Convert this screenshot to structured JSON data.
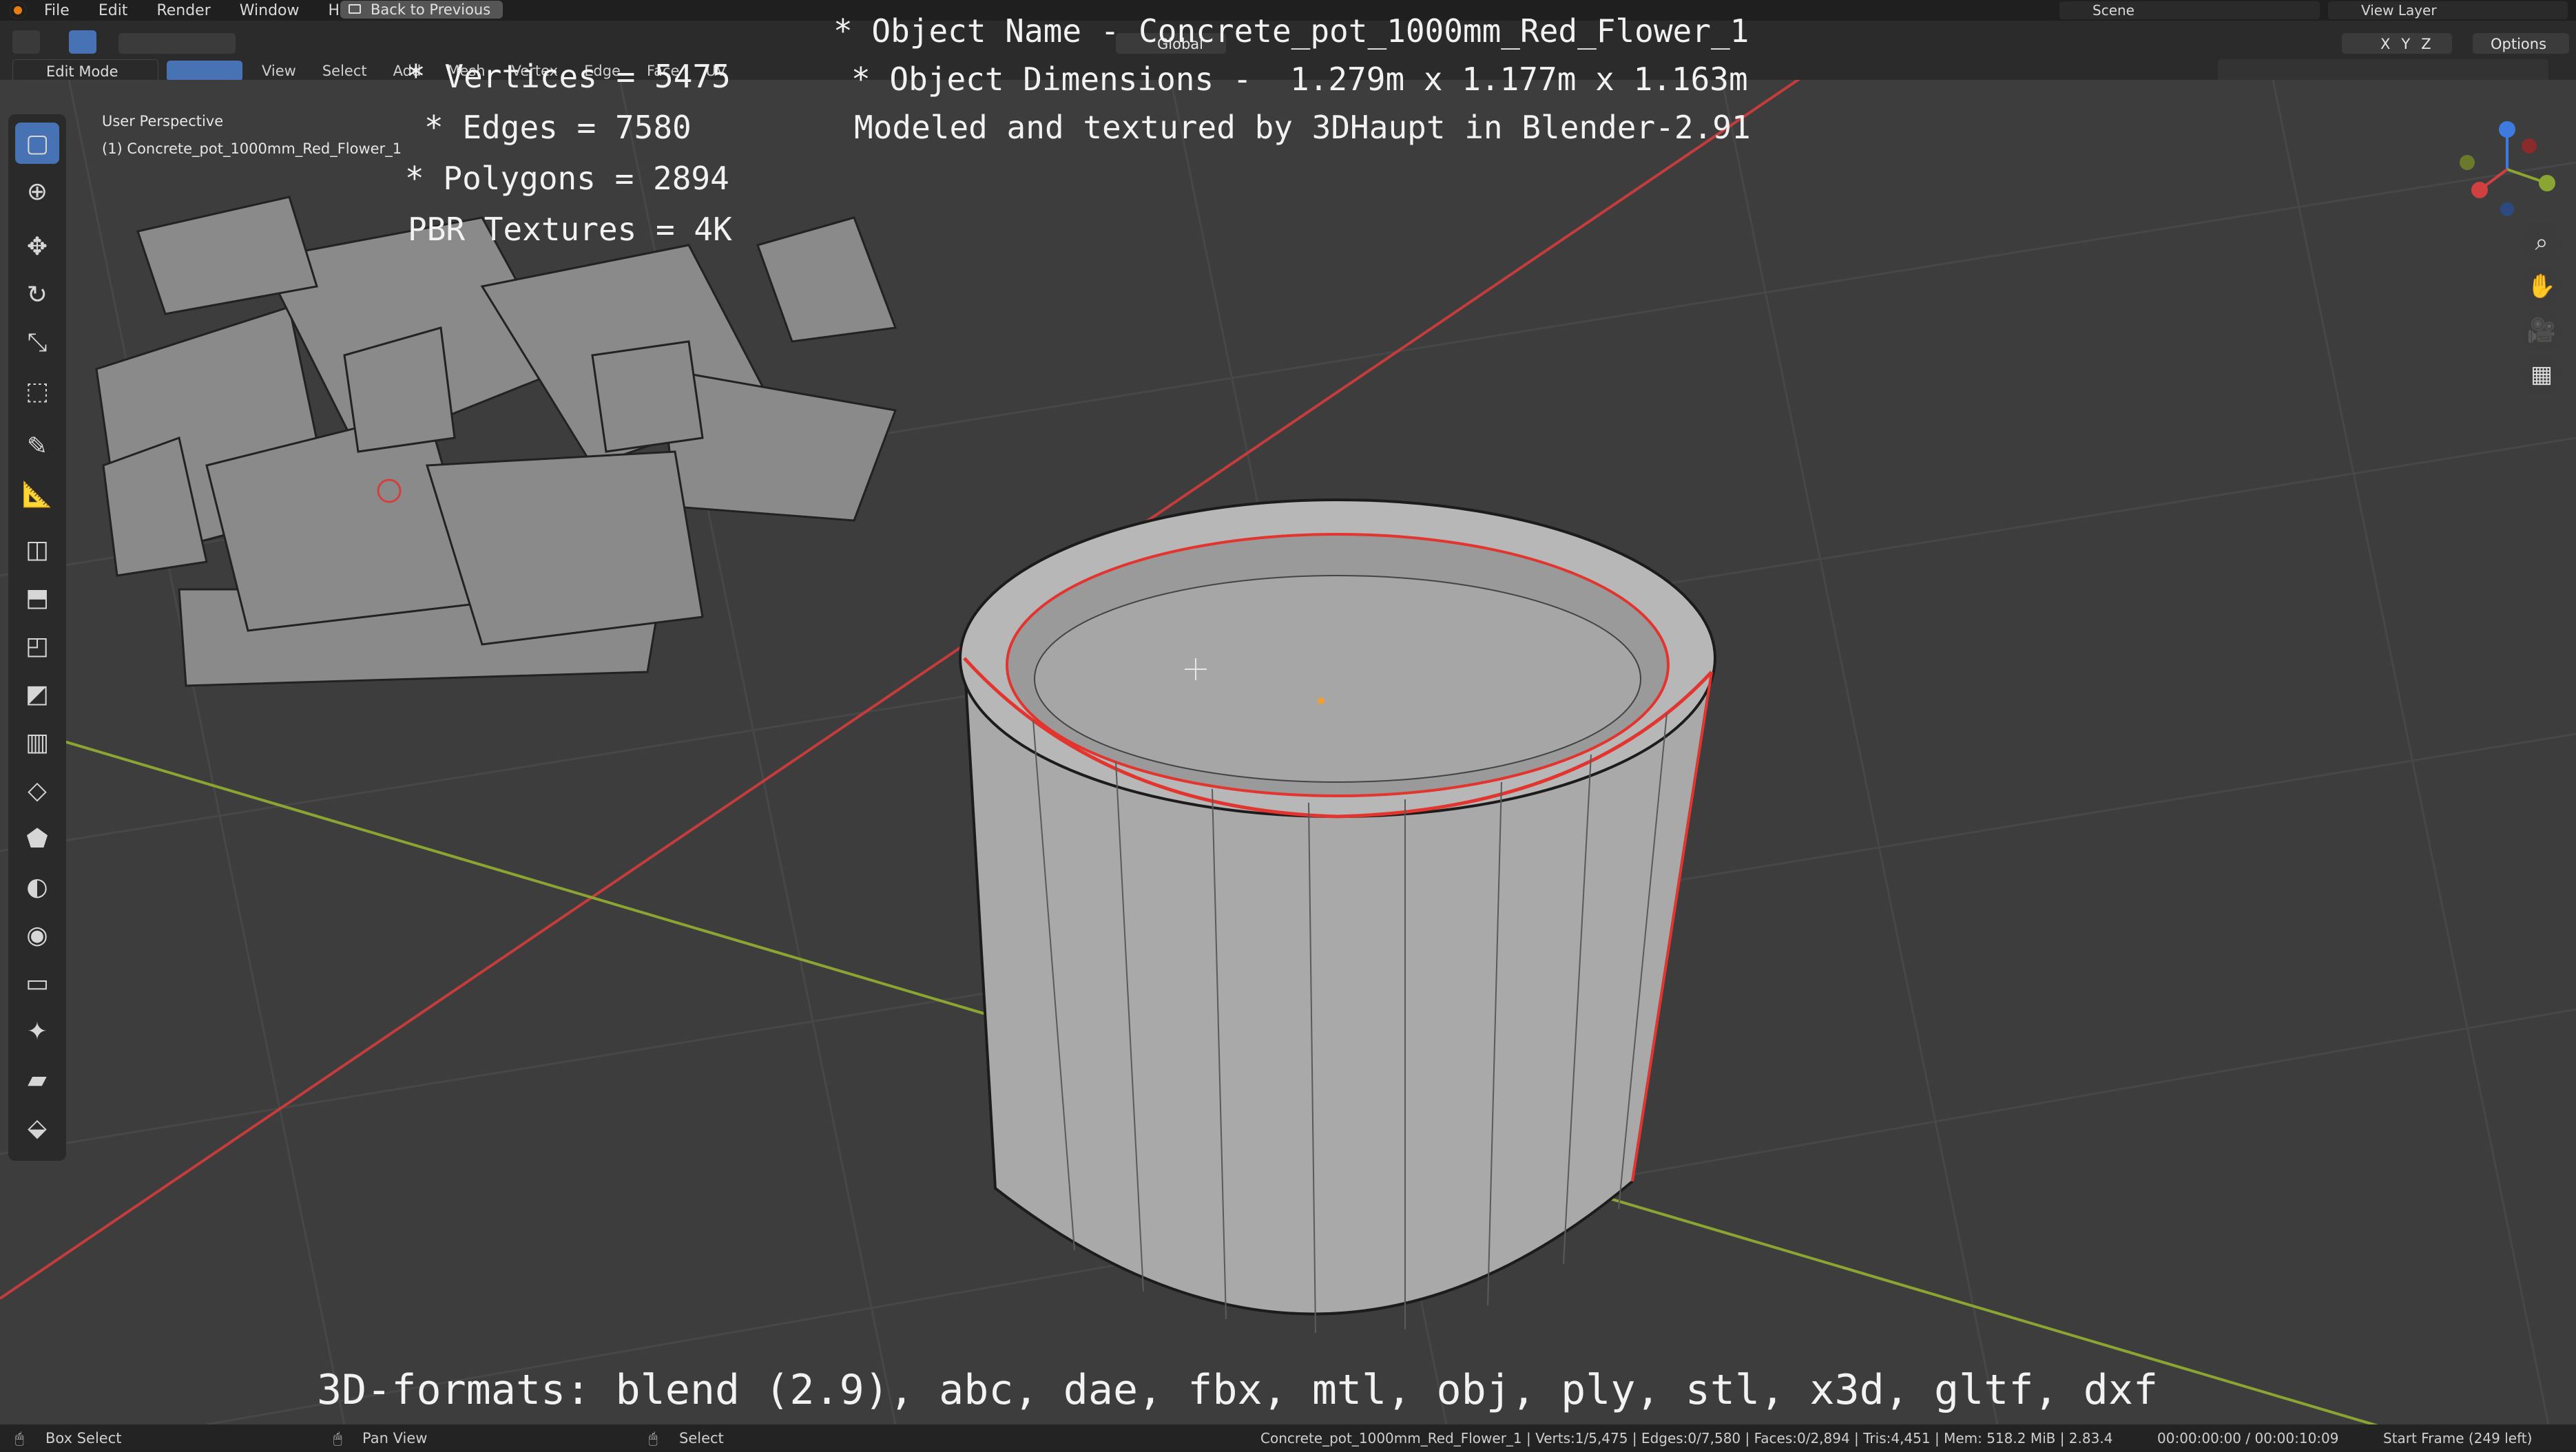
{
  "menu": {
    "items": [
      "File",
      "Edit",
      "Render",
      "Window",
      "Help"
    ],
    "back_button": "Back to Previous",
    "scene": "Scene",
    "view_layer": "View Layer"
  },
  "header": {
    "mode": "Edit Mode",
    "menus": [
      "View",
      "Select",
      "Add",
      "Mesh",
      "Vertex",
      "Edge",
      "Face",
      "UV"
    ],
    "transform_orientation": "Global",
    "axes": [
      "X",
      "Y",
      "Z"
    ],
    "options": "Options"
  },
  "viewport": {
    "perspective": "User Perspective",
    "object_label": "(1) Concrete_pot_1000mm_Red_Flower_1"
  },
  "overlay": {
    "object_name": "* Object Name - Concrete_pot_1000mm_Red_Flower_1",
    "dimensions": "* Object Dimensions -  1.279m x 1.177m x 1.163m",
    "credits": "Modeled and textured by 3DHaupt in Blender-2.91",
    "vertices": "* Vertices = 5475",
    "edges": "* Edges = 7580",
    "polygons": "* Polygons = 2894",
    "textures": "PBR Textures = 4K",
    "formats": "3D-formats: blend (2.9), abc, dae, fbx, mtl, obj, ply, stl, x3d, gltf, dxf"
  },
  "statusbar": {
    "box_select": "Box Select",
    "pan_view": "Pan View",
    "select": "Select",
    "stats": "Concrete_pot_1000mm_Red_Flower_1 | Verts:1/5,475 | Edges:0/7,580 | Faces:0/2,894 | Tris:4,451 | Mem: 518.2 MiB | 2.83.4",
    "time": "00:00:00:00 / 00:00:10:09",
    "frame": "Start Frame (249 left)"
  },
  "colors": {
    "background": "#3d3d3d",
    "accent": "#4772b3",
    "x_axis": "#c43c3c",
    "y_axis": "#8ba532",
    "selection_edge": "#e2352f"
  }
}
